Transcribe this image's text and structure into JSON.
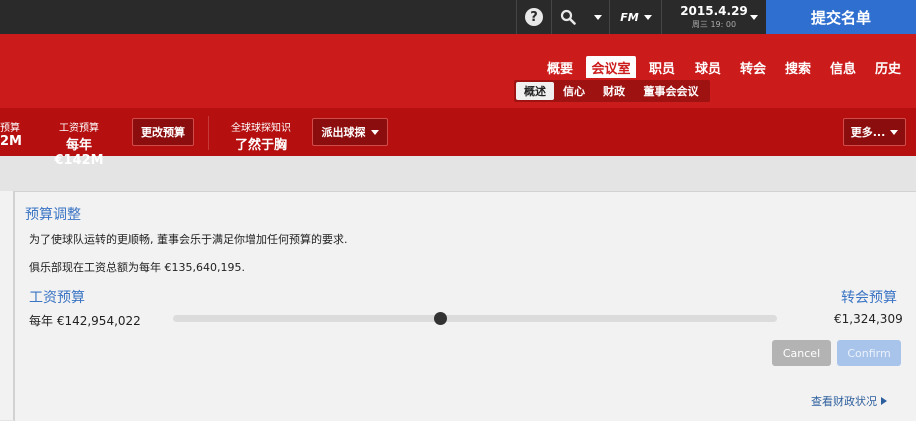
{
  "topbar": {
    "help_glyph": "?",
    "fm_label": "FM",
    "date_main": "2015.4.29",
    "date_sub": "周三 19: 00",
    "submit_label": "提交名单"
  },
  "nav": {
    "tabs": [
      "概要",
      "会议室",
      "职员",
      "球员",
      "转会",
      "搜索",
      "信息",
      "历史"
    ],
    "active_tab": "会议室",
    "subtabs": [
      "概述",
      "信心",
      "财政",
      "董事会会议"
    ],
    "active_subtab": "概述"
  },
  "strip": {
    "cut_label": "预算",
    "cut_value": "2M",
    "wage_label": "工资预算",
    "wage_value": "每年 €142M",
    "change_budget_label": "更改预算",
    "scout_label": "全球球探知识",
    "scout_value": "了然于胸",
    "send_scout_label": "派出球探",
    "more_label": "更多..."
  },
  "panel": {
    "title": "预算调整",
    "line1": "为了使球队运转的更顺畅, 董事会乐于满足你增加任何预算的要求.",
    "line2": "俱乐部现在工资总额为每年 €135,640,195.",
    "wage_label": "工资预算",
    "wage_amount": "每年 €142,954,022",
    "transfer_label": "转会预算",
    "transfer_amount": "€1,324,309",
    "cancel_label": "Cancel",
    "confirm_label": "Confirm",
    "finance_link": "查看财政状况"
  },
  "colors": {
    "header_red": "#cc1b1b",
    "strip_red": "#b50f0f",
    "accent_blue": "#2f6fcf",
    "title_blue": "#3a74c4"
  }
}
